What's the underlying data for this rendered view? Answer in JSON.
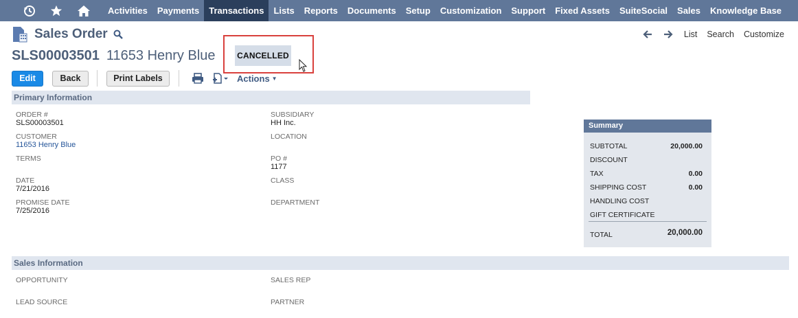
{
  "nav": {
    "icons": [
      "recent-icon",
      "star-icon",
      "home-icon"
    ],
    "items": [
      {
        "label": "Activities",
        "active": false
      },
      {
        "label": "Payments",
        "active": false
      },
      {
        "label": "Transactions",
        "active": true
      },
      {
        "label": "Lists",
        "active": false
      },
      {
        "label": "Reports",
        "active": false
      },
      {
        "label": "Documents",
        "active": false
      },
      {
        "label": "Setup",
        "active": false
      },
      {
        "label": "Customization",
        "active": false
      },
      {
        "label": "Support",
        "active": false
      },
      {
        "label": "Fixed Assets",
        "active": false
      },
      {
        "label": "SuiteSocial",
        "active": false
      },
      {
        "label": "Sales",
        "active": false
      },
      {
        "label": "Knowledge Base",
        "active": false
      }
    ]
  },
  "header": {
    "title": "Sales Order",
    "record_id": "SLS00003501",
    "record_name": "11653 Henry Blue",
    "status": "CANCELLED",
    "links": {
      "list": "List",
      "search": "Search",
      "customize": "Customize"
    }
  },
  "toolbar": {
    "edit": "Edit",
    "back": "Back",
    "print_labels": "Print Labels",
    "actions": "Actions"
  },
  "primary": {
    "heading": "Primary Information",
    "fields": {
      "order_label": "ORDER #",
      "order_value": "SLS00003501",
      "customer_label": "CUSTOMER",
      "customer_value": "11653 Henry Blue",
      "terms_label": "TERMS",
      "date_label": "DATE",
      "date_value": "7/21/2016",
      "promise_label": "PROMISE DATE",
      "promise_value": "7/25/2016",
      "subsidiary_label": "SUBSIDIARY",
      "subsidiary_value": "HH Inc.",
      "location_label": "LOCATION",
      "po_label": "PO #",
      "po_value": "1177",
      "class_label": "CLASS",
      "department_label": "DEPARTMENT"
    }
  },
  "summary": {
    "heading": "Summary",
    "subtotal_label": "SUBTOTAL",
    "subtotal_value": "20,000.00",
    "discount_label": "DISCOUNT",
    "tax_label": "TAX",
    "tax_value": "0.00",
    "shipping_label": "SHIPPING COST",
    "shipping_value": "0.00",
    "handling_label": "HANDLING COST",
    "gift_label": "GIFT CERTIFICATE",
    "total_label": "TOTAL",
    "total_value": "20,000.00"
  },
  "sales": {
    "heading": "Sales Information",
    "opportunity_label": "OPPORTUNITY",
    "lead_source_label": "LEAD SOURCE",
    "sales_rep_label": "SALES REP",
    "partner_label": "PARTNER"
  },
  "colors": {
    "nav_bg": "#607799",
    "nav_active": "#2b3f5c",
    "primary_button": "#1a8ae6",
    "highlight_box": "#d9403c"
  }
}
